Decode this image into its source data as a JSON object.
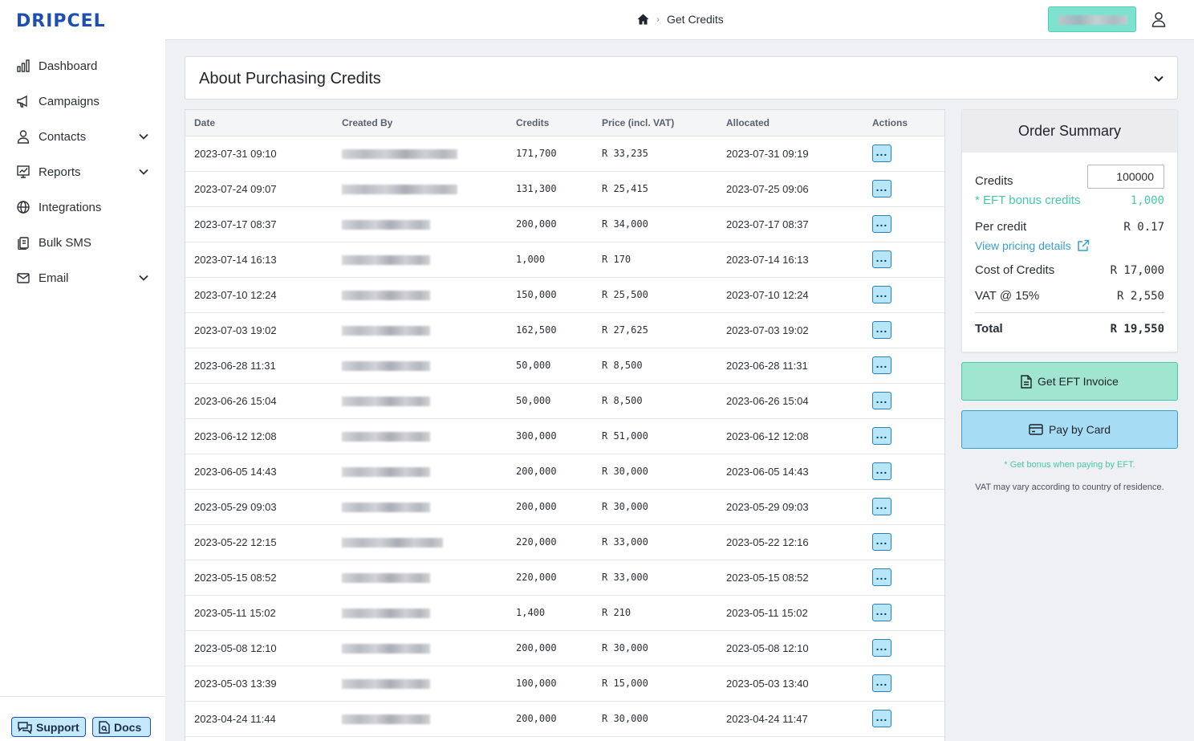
{
  "app": {
    "logo": "DRIPCEL"
  },
  "sidebar": {
    "items": [
      {
        "label": "Dashboard",
        "icon": "bar-chart-icon",
        "has_chevron": false
      },
      {
        "label": "Campaigns",
        "icon": "megaphone-icon",
        "has_chevron": false
      },
      {
        "label": "Contacts",
        "icon": "person-icon",
        "has_chevron": true
      },
      {
        "label": "Reports",
        "icon": "chart-board-icon",
        "has_chevron": true
      },
      {
        "label": "Integrations",
        "icon": "globe-icon",
        "has_chevron": false
      },
      {
        "label": "Bulk SMS",
        "icon": "phone-stack-icon",
        "has_chevron": false
      },
      {
        "label": "Email",
        "icon": "envelope-icon",
        "has_chevron": true
      }
    ],
    "support_label": "Support",
    "docs_label": "Docs"
  },
  "header": {
    "breadcrumb": {
      "current": "Get Credits"
    }
  },
  "about": {
    "title": "About Purchasing Credits"
  },
  "table": {
    "columns": [
      "Date",
      "Created By",
      "Credits",
      "Price (incl. VAT)",
      "Allocated",
      "Actions"
    ],
    "rows": [
      {
        "date": "2023-07-31 09:10",
        "credits": "171,700",
        "price": "R 33,235",
        "allocated": "2023-07-31 09:19"
      },
      {
        "date": "2023-07-24 09:07",
        "credits": "131,300",
        "price": "R 25,415",
        "allocated": "2023-07-25 09:06"
      },
      {
        "date": "2023-07-17 08:37",
        "credits": "200,000",
        "price": "R 34,000",
        "allocated": "2023-07-17 08:37"
      },
      {
        "date": "2023-07-14 16:13",
        "credits": "1,000",
        "price": "R 170",
        "allocated": "2023-07-14 16:13"
      },
      {
        "date": "2023-07-10 12:24",
        "credits": "150,000",
        "price": "R 25,500",
        "allocated": "2023-07-10 12:24"
      },
      {
        "date": "2023-07-03 19:02",
        "credits": "162,500",
        "price": "R 27,625",
        "allocated": "2023-07-03 19:02"
      },
      {
        "date": "2023-06-28 11:31",
        "credits": "50,000",
        "price": "R 8,500",
        "allocated": "2023-06-28 11:31"
      },
      {
        "date": "2023-06-26 15:04",
        "credits": "50,000",
        "price": "R 8,500",
        "allocated": "2023-06-26 15:04"
      },
      {
        "date": "2023-06-12 12:08",
        "credits": "300,000",
        "price": "R 51,000",
        "allocated": "2023-06-12 12:08"
      },
      {
        "date": "2023-06-05 14:43",
        "credits": "200,000",
        "price": "R 30,000",
        "allocated": "2023-06-05 14:43"
      },
      {
        "date": "2023-05-29 09:03",
        "credits": "200,000",
        "price": "R 30,000",
        "allocated": "2023-05-29 09:03"
      },
      {
        "date": "2023-05-22 12:15",
        "credits": "220,000",
        "price": "R 33,000",
        "allocated": "2023-05-22 12:16"
      },
      {
        "date": "2023-05-15 08:52",
        "credits": "220,000",
        "price": "R 33,000",
        "allocated": "2023-05-15 08:52"
      },
      {
        "date": "2023-05-11 15:02",
        "credits": "1,400",
        "price": "R 210",
        "allocated": "2023-05-11 15:02"
      },
      {
        "date": "2023-05-08 12:10",
        "credits": "200,000",
        "price": "R 30,000",
        "allocated": "2023-05-08 12:10"
      },
      {
        "date": "2023-05-03 13:39",
        "credits": "100,000",
        "price": "R 15,000",
        "allocated": "2023-05-03 13:40"
      },
      {
        "date": "2023-04-24 11:44",
        "credits": "200,000",
        "price": "R 30,000",
        "allocated": "2023-04-24 11:47"
      }
    ]
  },
  "summary": {
    "title": "Order Summary",
    "credits_label": "Credits",
    "credits_value": "100000",
    "bonus_label": "* EFT bonus credits",
    "bonus_value": "1,000",
    "per_credit_label": "Per credit",
    "per_credit_value": "R 0.17",
    "pricing_link": "View pricing details",
    "cost_label": "Cost of Credits",
    "cost_value": "R 17,000",
    "vat_label": "VAT @ 15%",
    "vat_value": "R 2,550",
    "total_label": "Total",
    "total_value": "R 19,550"
  },
  "actions": {
    "eft_label": "Get EFT Invoice",
    "card_label": "Pay by Card",
    "bonus_note": "* Get bonus when paying by EFT.",
    "vat_note": "VAT may vary according to country of residence."
  },
  "colors": {
    "brand": "#1d4fb0",
    "eft_green": "#46c9a6",
    "card_blue": "#3aa0c9"
  }
}
